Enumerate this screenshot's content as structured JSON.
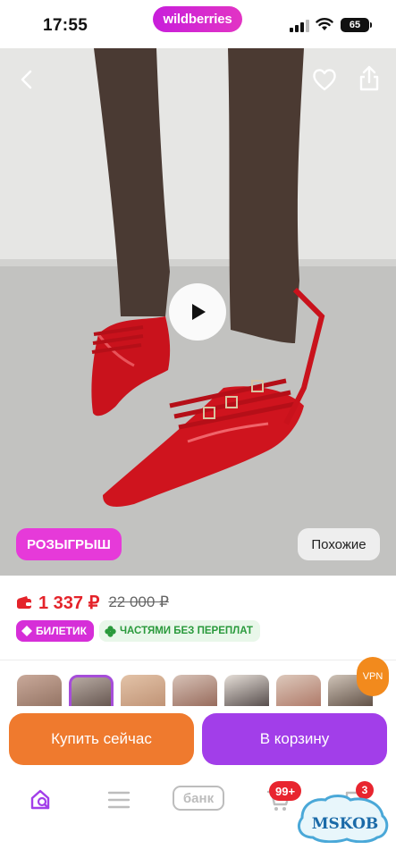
{
  "status_bar": {
    "time": "17:55",
    "brand": "wildberries",
    "battery": "65"
  },
  "product": {
    "raffle_label": "РОЗЫГРЫШ",
    "similar_label": "Похожие",
    "price_current": "1 337 ₽",
    "price_old": "22 000 ₽",
    "tags": {
      "ticket": "БИЛЕТИК",
      "installments": "ЧАСТЯМИ БЕЗ ПЕРЕПЛАТ"
    }
  },
  "overlay": {
    "vpn": "VPN"
  },
  "actions": {
    "buy_now": "Купить сейчас",
    "add_to_cart": "В корзину"
  },
  "bottom_nav": {
    "bank": "банк",
    "cart_count": "99+",
    "chat_count": "3"
  },
  "watermark": {
    "text": "MSKOB"
  },
  "colors": {
    "brand": "#cb11ab",
    "price": "#e4232a",
    "buy_now": "#ef7a2e",
    "cart": "#a23ee9"
  }
}
